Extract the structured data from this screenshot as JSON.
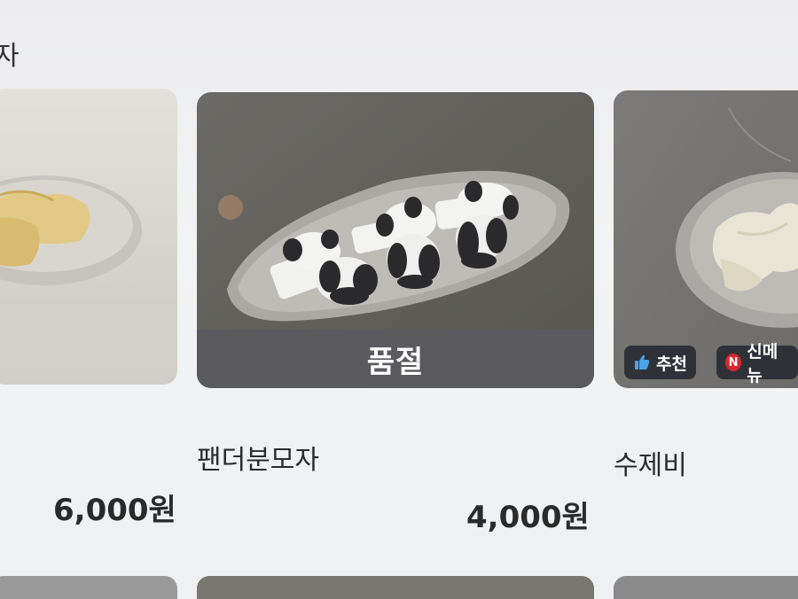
{
  "section": {
    "title": "자"
  },
  "cards": [
    {
      "name": "",
      "price": "6,000원"
    },
    {
      "name": "팬더분모자",
      "price": "4,000원",
      "status": "품절"
    },
    {
      "name": "수제비",
      "badges": {
        "recommend": "추천",
        "new_icon": "N",
        "new": "신메뉴"
      }
    }
  ],
  "colors": {
    "soldout_bar": "#5a5a5f",
    "badge_bg": "#2e3238",
    "new_red": "#d8262c",
    "thumb_blue": "#4aa3e8"
  }
}
